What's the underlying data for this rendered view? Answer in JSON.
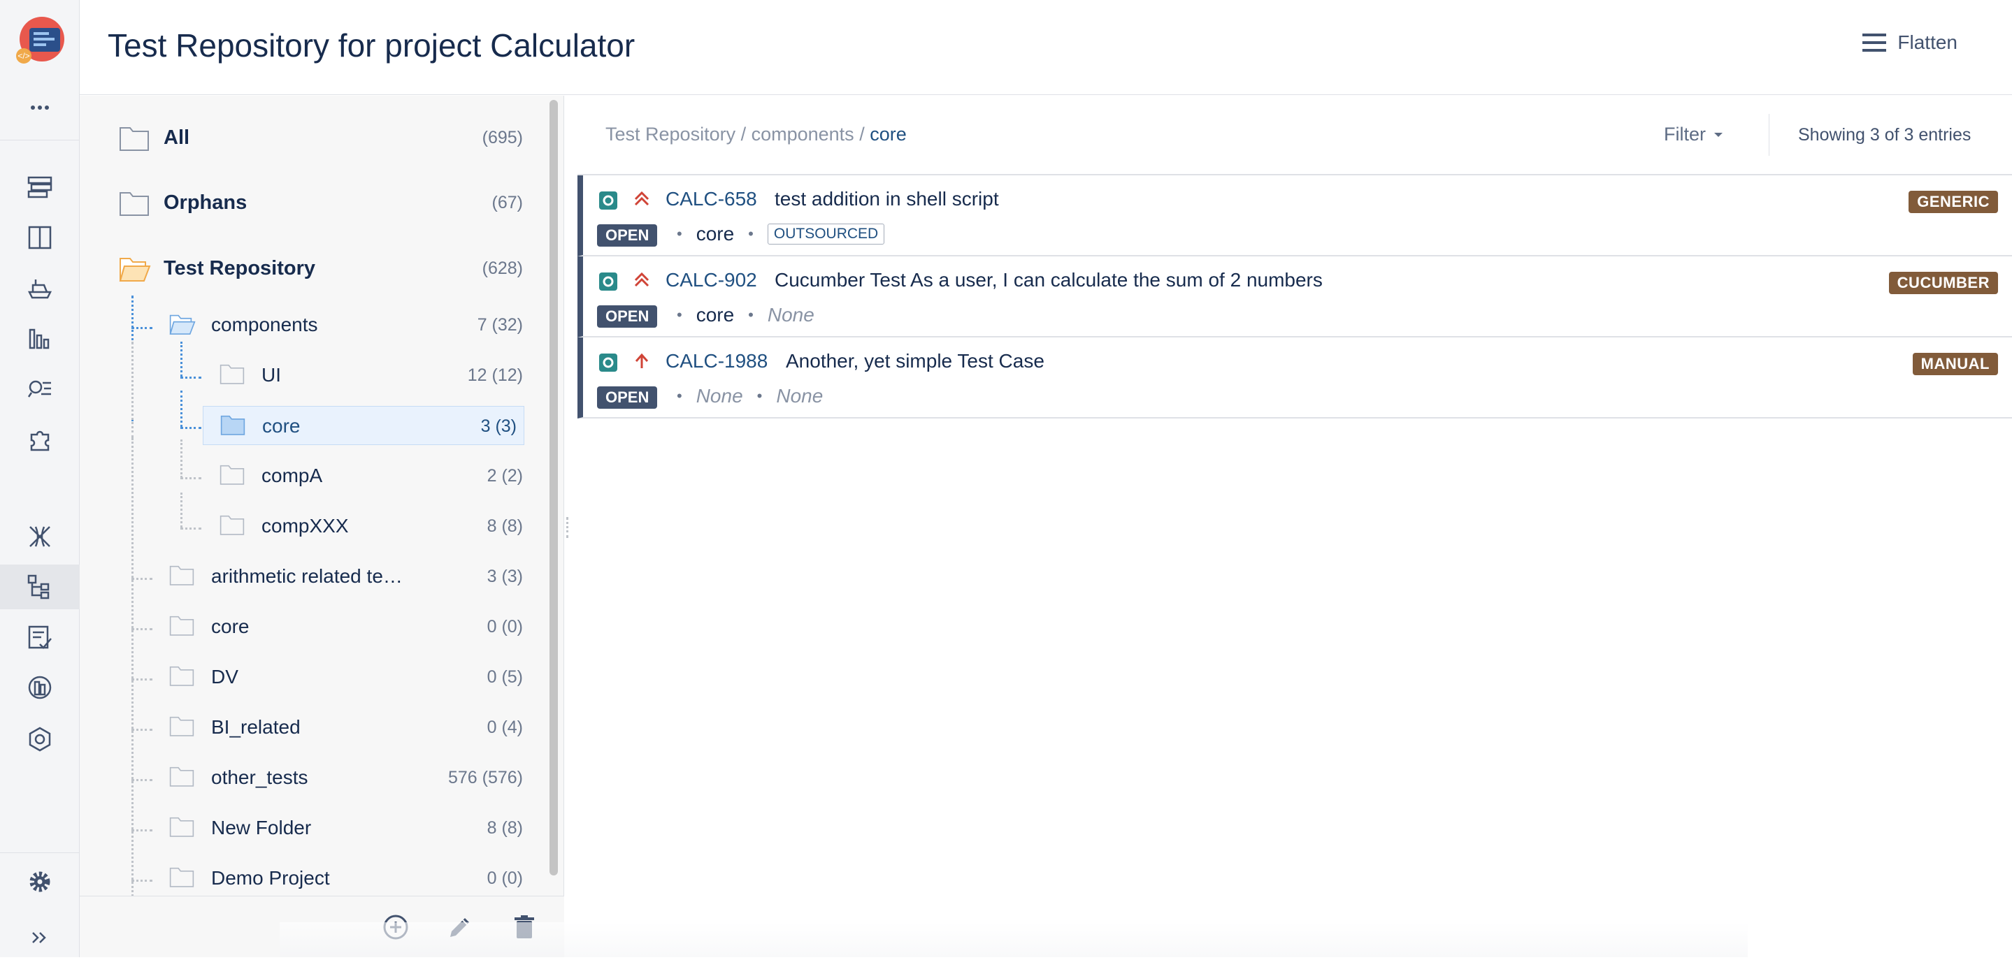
{
  "header": {
    "title": "Test Repository for project Calculator",
    "flatten_label": "Flatten"
  },
  "rail": {
    "icons": [
      "more-icon",
      "board-icon",
      "columns-icon",
      "ship-icon",
      "reports-icon",
      "search-issues-icon",
      "add-ons-icon",
      "xray-icon",
      "test-repository-icon",
      "test-plan-icon",
      "test-runs-icon",
      "component-icon",
      "settings-icon",
      "expand-icon"
    ]
  },
  "tree": {
    "nodes": [
      {
        "label": "All",
        "count": "(695)"
      },
      {
        "label": "Orphans",
        "count": "(67)"
      },
      {
        "label": "Test Repository",
        "count": "(628)"
      },
      {
        "label": "components",
        "count": "7 (32)"
      },
      {
        "label": "UI",
        "count": "12 (12)"
      },
      {
        "label": "core",
        "count": "3 (3)"
      },
      {
        "label": "compA",
        "count": "2 (2)"
      },
      {
        "label": "compXXX",
        "count": "8 (8)"
      },
      {
        "label": "arithmetic related te…",
        "count": "3 (3)"
      },
      {
        "label": "core",
        "count": "0 (0)"
      },
      {
        "label": "DV",
        "count": "0 (5)"
      },
      {
        "label": "BI_related",
        "count": "0 (4)"
      },
      {
        "label": "other_tests",
        "count": "576 (576)"
      },
      {
        "label": "New Folder",
        "count": "8 (8)"
      },
      {
        "label": "Demo Project",
        "count": "0 (0)"
      }
    ],
    "toolbar": [
      "add-folder-icon",
      "edit-icon",
      "delete-icon"
    ]
  },
  "main": {
    "breadcrumb": {
      "root": "Test Repository",
      "sep": " / ",
      "parent": "components",
      "current": "core"
    },
    "filter_label": "Filter",
    "showing": "Showing 3 of 3 entries",
    "tests": [
      {
        "key": "CALC-658",
        "summary": "test addition in shell script",
        "status": "OPEN",
        "component": "core",
        "label": "OUTSOURCED",
        "type": "GENERIC",
        "priority": "highest"
      },
      {
        "key": "CALC-902",
        "summary": "Cucumber Test As a user, I can calculate the sum of 2 numbers",
        "status": "OPEN",
        "component": "core",
        "label": "None",
        "type": "CUCUMBER",
        "priority": "highest"
      },
      {
        "key": "CALC-1988",
        "summary": "Another, yet simple Test Case",
        "status": "OPEN",
        "component": "None",
        "label": "None",
        "type": "MANUAL",
        "priority": "high"
      }
    ]
  },
  "colors": {
    "link": "#205081",
    "status_bg": "#42526e",
    "type_badge": "#815b3a",
    "priority": "#d04437",
    "folder_open": "#f0a94a",
    "folder_selected": "#6ea6e0"
  }
}
